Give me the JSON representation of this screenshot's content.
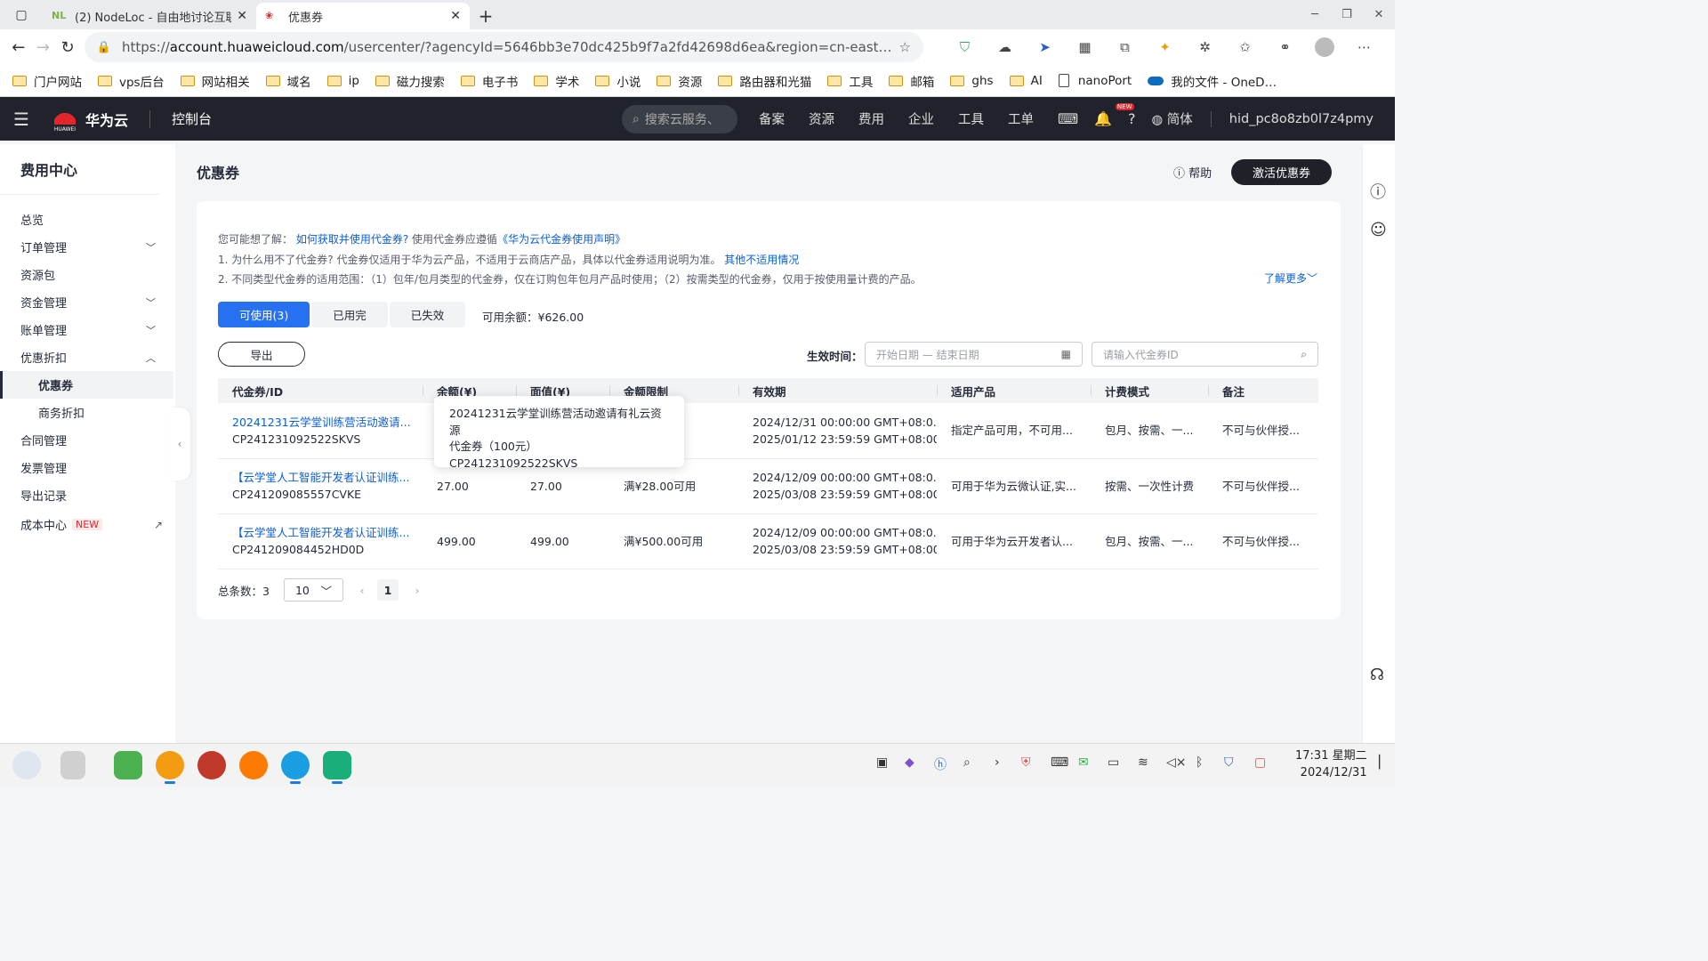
{
  "browser": {
    "tabs": [
      {
        "favicon": "NL",
        "title": "(2) NodeLoc - 自由地讨论互联"
      },
      {
        "favicon": "huawei-icon",
        "title": "优惠券"
      }
    ],
    "url_prefix": "https://",
    "url_domain": "account.huaweicloud.com",
    "url_rest": "/usercenter/?agencyId=5646bb3e70dc425b9f7a2fd42698d6ea&region=cn-east…",
    "bookmarks": [
      "门户网站",
      "vps后台",
      "网站相关",
      "域名",
      "ip",
      "磁力搜索",
      "电子书",
      "学术",
      "小说",
      "资源",
      "路由器和光猫",
      "工具",
      "邮箱",
      "ghs",
      "AI",
      "nanoPort",
      "我的文件 - OneD…"
    ]
  },
  "header": {
    "brand": "华为云",
    "brand_sub": "HUAWEI",
    "console": "控制台",
    "search_placeholder": "搜索云服务、",
    "menu": [
      "备案",
      "资源",
      "费用",
      "企业",
      "工具",
      "工单"
    ],
    "new_badge": "NEW",
    "lang": "简体",
    "user": "hid_pc8o8zb0l7z4pmy"
  },
  "sidebar": {
    "title": "费用中心",
    "items": [
      {
        "label": "总览"
      },
      {
        "label": "订单管理"
      },
      {
        "label": "资源包"
      },
      {
        "label": "资金管理"
      },
      {
        "label": "账单管理"
      },
      {
        "label": "优惠折扣"
      },
      {
        "label": "优惠券"
      },
      {
        "label": "商务折扣"
      },
      {
        "label": "合同管理"
      },
      {
        "label": "发票管理"
      },
      {
        "label": "导出记录"
      },
      {
        "label": "成本中心",
        "tag": "NEW"
      }
    ]
  },
  "page": {
    "title": "优惠券",
    "help": "帮助",
    "activate": "激活优惠券",
    "tips": {
      "lead": "您可能想了解：",
      "link1": "如何获取并使用代金券?",
      "mid": "使用代金券应遵循",
      "link2": "《华为云代金券使用声明》",
      "line1": "1. 为什么用不了代金券? 代金券仅适用于华为云产品，不适用于云商店产品，具体以代金券适用说明为准。",
      "line1_link": "其他不适用情况",
      "line2": "2. 不同类型代金券的适用范围：（1）包年/包月类型的代金券，仅在订购包年包月产品时使用；（2）按需类型的代金券，仅用于按使用量计费的产品。",
      "more": "了解更多"
    },
    "tabs": [
      "可使用(3)",
      "已用完",
      "已失效"
    ],
    "balance": "可用余额：¥626.00",
    "export": "导出",
    "effective_label": "生效时间：",
    "date_placeholder": "开始日期 — 结束日期",
    "id_placeholder": "请输入代金券ID",
    "columns": [
      "代金券/ID",
      "余额(¥)",
      "面值(¥)",
      "金额限制",
      "有效期",
      "适用产品",
      "计费模式",
      "备注"
    ],
    "rows": [
      {
        "name": "20241231云学堂训练营活动邀请...",
        "id": "CP241231092522SKVS",
        "balance": "",
        "face": "",
        "limit": "",
        "start": "2024/12/31 00:00:00 GMT+08:0...",
        "end": "2025/01/12 23:59:59 GMT+08:00",
        "product": "指定产品可用，不可用...",
        "mode": "包月、按需、一...",
        "note": "不可与伙伴授..."
      },
      {
        "name": "【云学堂人工智能开发者认证训练...",
        "id": "CP241209085557CVKE",
        "balance": "27.00",
        "face": "27.00",
        "limit": "满¥28.00可用",
        "start": "2024/12/09 00:00:00 GMT+08:0...",
        "end": "2025/03/08 23:59:59 GMT+08:00",
        "product": "可用于华为云微认证,实...",
        "mode": "按需、一次性计费",
        "note": "不可与伙伴授..."
      },
      {
        "name": "【云学堂人工智能开发者认证训练...",
        "id": "CP241209084452HD0D",
        "balance": "499.00",
        "face": "499.00",
        "limit": "满¥500.00可用",
        "start": "2024/12/09 00:00:00 GMT+08:0...",
        "end": "2025/03/08 23:59:59 GMT+08:00",
        "product": "可用于华为云开发者认...",
        "mode": "包月、按需、一...",
        "note": "不可与伙伴授..."
      }
    ],
    "pager": {
      "total_label": "总条数：",
      "total": "3",
      "page_size": "10",
      "current": "1"
    },
    "tooltip": {
      "line1": "20241231云学堂训练营活动邀请有礼云资源",
      "line2": "代金券（100元）",
      "line3": "CP241231092522SKVS"
    }
  },
  "taskbar": {
    "time": "17:31 星期二",
    "date": "2024/12/31"
  }
}
